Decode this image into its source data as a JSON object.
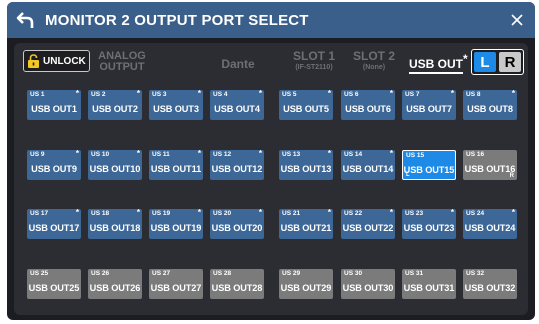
{
  "header": {
    "title": "MONITOR 2 OUTPUT PORT SELECT",
    "back_icon": "back-arrow-icon",
    "close_icon": "close-icon",
    "color": "#3a5f8a"
  },
  "unlock": {
    "label": "UNLOCK",
    "icon": "lock-icon"
  },
  "tabs": [
    {
      "line1": "ANALOG",
      "line2": "OUTPUT",
      "active": false
    },
    {
      "line1": "Dante",
      "line2": "",
      "active": false
    },
    {
      "line1": "SLOT 1",
      "line2": "(IF-ST2110)",
      "active": false
    },
    {
      "line1": "SLOT 2",
      "line2": "(None)",
      "active": false
    },
    {
      "line1": "USB OUT",
      "line2": "",
      "active": true,
      "star": "*"
    }
  ],
  "lr": {
    "left": "L",
    "right": "R",
    "selected": "L"
  },
  "colors": {
    "assigned": "#3c6797",
    "unassigned": "#7b7b7b",
    "selected": "#1c8ae6"
  },
  "ports": [
    {
      "num": "US 1",
      "name": "USB OUT1",
      "state": "assigned",
      "star": "*"
    },
    {
      "num": "US 2",
      "name": "USB OUT2",
      "state": "assigned",
      "star": "*"
    },
    {
      "num": "US 3",
      "name": "USB OUT3",
      "state": "assigned",
      "star": "*"
    },
    {
      "num": "US 4",
      "name": "USB OUT4",
      "state": "assigned",
      "star": "*"
    },
    {
      "num": "US 5",
      "name": "USB OUT5",
      "state": "assigned",
      "star": "*"
    },
    {
      "num": "US 6",
      "name": "USB OUT6",
      "state": "assigned",
      "star": "*"
    },
    {
      "num": "US 7",
      "name": "USB OUT7",
      "state": "assigned",
      "star": "*"
    },
    {
      "num": "US 8",
      "name": "USB OUT8",
      "state": "assigned",
      "star": "*"
    },
    {
      "num": "US 9",
      "name": "USB OUT9",
      "state": "assigned",
      "star": "*"
    },
    {
      "num": "US 10",
      "name": "USB OUT10",
      "state": "assigned",
      "star": "*"
    },
    {
      "num": "US 11",
      "name": "USB OUT11",
      "state": "assigned",
      "star": "*"
    },
    {
      "num": "US 12",
      "name": "USB OUT12",
      "state": "assigned",
      "star": "*"
    },
    {
      "num": "US 13",
      "name": "USB OUT13",
      "state": "assigned",
      "star": "*"
    },
    {
      "num": "US 14",
      "name": "USB OUT14",
      "state": "assigned",
      "star": "*"
    },
    {
      "num": "US 15",
      "name": "USB OUT15",
      "state": "selected",
      "star": "",
      "ch": "L"
    },
    {
      "num": "US 16",
      "name": "USB OUT16",
      "state": "unassigned",
      "star": "",
      "ch": "R"
    },
    {
      "num": "US 17",
      "name": "USB OUT17",
      "state": "assigned",
      "star": "*"
    },
    {
      "num": "US 18",
      "name": "USB OUT18",
      "state": "assigned",
      "star": "*"
    },
    {
      "num": "US 19",
      "name": "USB OUT19",
      "state": "assigned",
      "star": "*"
    },
    {
      "num": "US 20",
      "name": "USB OUT20",
      "state": "assigned",
      "star": "*"
    },
    {
      "num": "US 21",
      "name": "USB OUT21",
      "state": "assigned",
      "star": "*"
    },
    {
      "num": "US 22",
      "name": "USB OUT22",
      "state": "assigned",
      "star": "*"
    },
    {
      "num": "US 23",
      "name": "USB OUT23",
      "state": "assigned",
      "star": "*"
    },
    {
      "num": "US 24",
      "name": "USB OUT24",
      "state": "assigned",
      "star": "*"
    },
    {
      "num": "US 25",
      "name": "USB OUT25",
      "state": "unassigned",
      "star": ""
    },
    {
      "num": "US 26",
      "name": "USB OUT26",
      "state": "unassigned",
      "star": ""
    },
    {
      "num": "US 27",
      "name": "USB OUT27",
      "state": "unassigned",
      "star": ""
    },
    {
      "num": "US 28",
      "name": "USB OUT28",
      "state": "unassigned",
      "star": ""
    },
    {
      "num": "US 29",
      "name": "USB OUT29",
      "state": "unassigned",
      "star": ""
    },
    {
      "num": "US 30",
      "name": "USB OUT30",
      "state": "unassigned",
      "star": ""
    },
    {
      "num": "US 31",
      "name": "USB OUT31",
      "state": "unassigned",
      "star": ""
    },
    {
      "num": "US 32",
      "name": "USB OUT32",
      "state": "unassigned",
      "star": ""
    }
  ]
}
